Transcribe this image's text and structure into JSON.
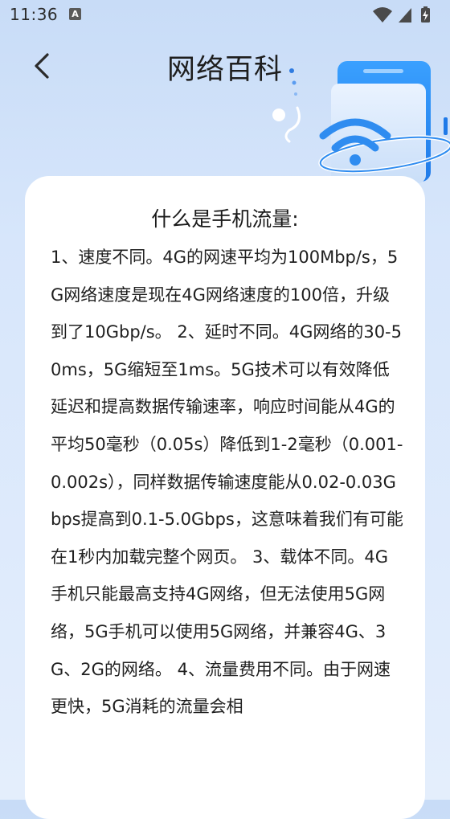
{
  "status_bar": {
    "time": "11:36",
    "notification_icon": "a-notification-icon",
    "wifi_icon": "wifi-icon",
    "signal_icon": "cellular-signal-icon",
    "battery_icon": "battery-charging-icon"
  },
  "header": {
    "back_icon": "chevron-left-icon",
    "title": "网络百科",
    "illustration": "phone-wifi-illustration"
  },
  "article": {
    "title": "什么是手机流量:",
    "body": "1、速度不同。4G的网速平均为100Mbp/s，5G网络速度是现在4G网络速度的100倍，升级到了10Gbp/s。 2、延时不同。4G网络的30-50ms，5G缩短至1ms。5G技术可以有效降低延迟和提高数据传输速率，响应时间能从4G的平均50毫秒（0.05s）降低到1-2毫秒（0.001-0.002s），同样数据传输速度能从0.02-0.03Gbps提高到0.1-5.0Gbps，这意味着我们有可能在1秒内加载完整个网页。 3、载体不同。4G手机只能最高支持4G网络，但无法使用5G网络，5G手机可以使用5G网络，并兼容4G、3G、2G的网络。 4、流量费用不同。由于网速更快，5G消耗的流量会相"
  },
  "colors": {
    "background_top": "#c8dcf7",
    "card": "#ffffff",
    "accent_blue": "#2f8cf0"
  }
}
